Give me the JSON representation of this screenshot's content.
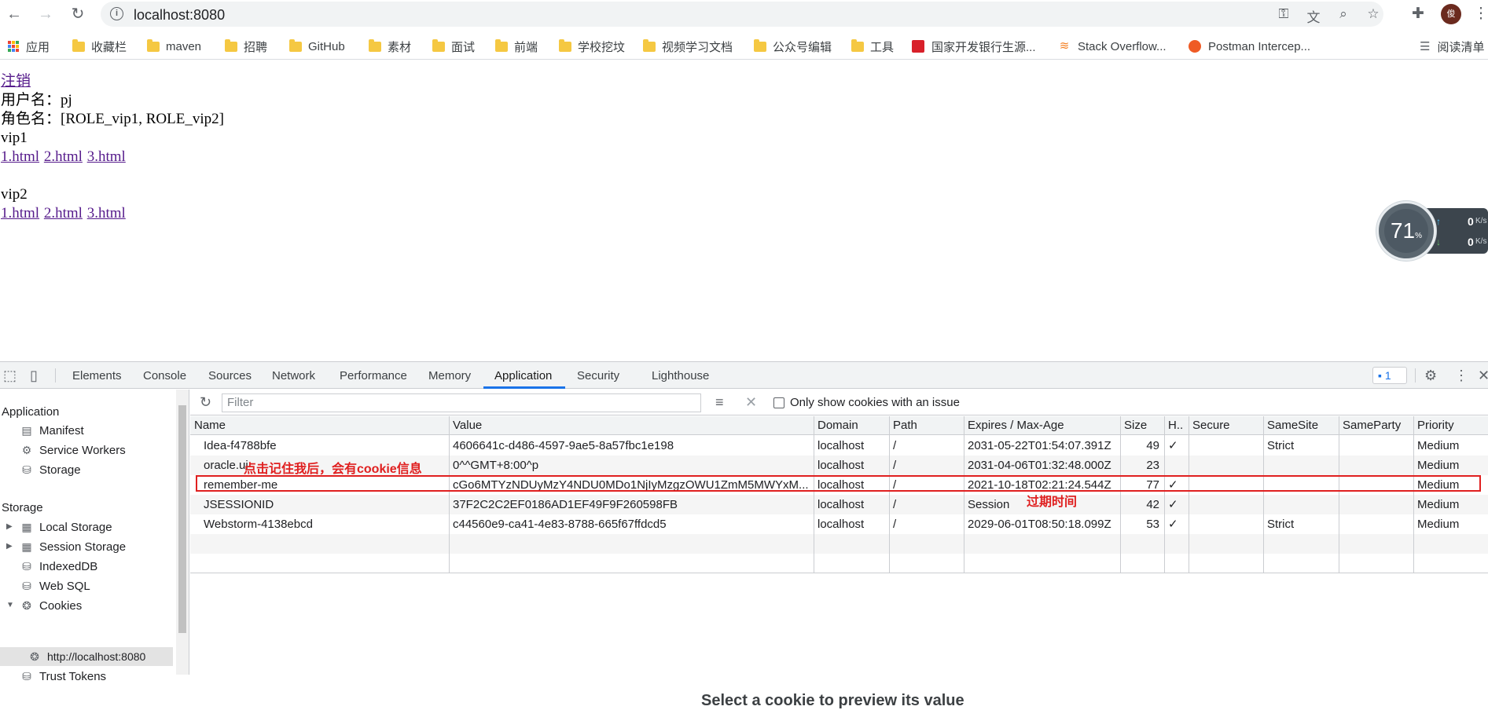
{
  "browser": {
    "url": "localhost:8080",
    "avatar_text": "俊",
    "bookmarks": [
      {
        "label": "应用",
        "type": "apps"
      },
      {
        "label": "收藏栏",
        "type": "folder"
      },
      {
        "label": "maven",
        "type": "folder"
      },
      {
        "label": "招聘",
        "type": "folder"
      },
      {
        "label": "GitHub",
        "type": "folder"
      },
      {
        "label": "素材",
        "type": "folder"
      },
      {
        "label": "面试",
        "type": "folder"
      },
      {
        "label": "前端",
        "type": "folder"
      },
      {
        "label": "学校挖坟",
        "type": "folder"
      },
      {
        "label": "视频学习文档",
        "type": "folder"
      },
      {
        "label": "公众号编辑",
        "type": "folder"
      },
      {
        "label": "工具",
        "type": "folder"
      },
      {
        "label": "国家开发银行生源...",
        "type": "site"
      },
      {
        "label": "Stack Overflow...",
        "type": "site"
      },
      {
        "label": "Postman Intercep...",
        "type": "site"
      },
      {
        "label": "阅读清单",
        "type": "reading-list"
      }
    ]
  },
  "page": {
    "logout": "注销",
    "username_line": "用户名：pj",
    "roles_line": "角色名：[ROLE_vip1, ROLE_vip2]",
    "sections": [
      {
        "title": "vip1",
        "links": [
          "1.html",
          "2.html",
          "3.html"
        ]
      },
      {
        "title": "vip2",
        "links": [
          "1.html",
          "2.html",
          "3.html"
        ]
      }
    ]
  },
  "net_widget": {
    "percent": "71",
    "percent_unit": "%",
    "up_value": "0",
    "down_value": "0",
    "unit": "K/s"
  },
  "devtools": {
    "tabs": [
      "Elements",
      "Console",
      "Sources",
      "Network",
      "Performance",
      "Memory",
      "Application",
      "Security",
      "Lighthouse"
    ],
    "active_tab": "Application",
    "issues_count": "1",
    "sidebar": {
      "application_header": "Application",
      "application_items": [
        "Manifest",
        "Service Workers",
        "Storage"
      ],
      "storage_header": "Storage",
      "storage_items": [
        "Local Storage",
        "Session Storage",
        "IndexedDB",
        "Web SQL",
        "Cookies"
      ],
      "cookie_origin": "http://localhost:8080",
      "trust_tokens": "Trust Tokens"
    },
    "filter_placeholder": "Filter",
    "only_issues_label": "Only show cookies with an issue",
    "columns": [
      "Name",
      "Value",
      "Domain",
      "Path",
      "Expires / Max-Age",
      "Size",
      "H..",
      "Secure",
      "SameSite",
      "SameParty",
      "Priority"
    ],
    "cookies": [
      {
        "name": "Idea-f4788bfe",
        "value": "4606641c-d486-4597-9ae5-8a57fbc1e198",
        "domain": "localhost",
        "path": "/",
        "expires": "2031-05-22T01:54:07.391Z",
        "size": "49",
        "http": "✓",
        "secure": "",
        "samesite": "Strict",
        "sameparty": "",
        "priority": "Medium"
      },
      {
        "name": "oracle.ui",
        "value": "0^^GMT+8:00^p",
        "domain": "localhost",
        "path": "/",
        "expires": "2031-04-06T01:32:48.000Z",
        "size": "23",
        "http": "",
        "secure": "",
        "samesite": "",
        "sameparty": "",
        "priority": "Medium"
      },
      {
        "name": "remember-me",
        "value": "cGo6MTYzNDUyMzY4NDU0MDo1NjIyMzgzOWU1ZmM5MWYxM...",
        "domain": "localhost",
        "path": "/",
        "expires": "2021-10-18T02:21:24.544Z",
        "size": "77",
        "http": "✓",
        "secure": "",
        "samesite": "",
        "sameparty": "",
        "priority": "Medium"
      },
      {
        "name": "JSESSIONID",
        "value": "37F2C2C2EF0186AD1EF49F9F260598FB",
        "domain": "localhost",
        "path": "/",
        "expires": "Session",
        "size": "42",
        "http": "✓",
        "secure": "",
        "samesite": "",
        "sameparty": "",
        "priority": "Medium"
      },
      {
        "name": "Webstorm-4138ebcd",
        "value": "c44560e9-ca41-4e83-8788-665f67ffdcd5",
        "domain": "localhost",
        "path": "/",
        "expires": "2029-06-01T08:50:18.099Z",
        "size": "53",
        "http": "✓",
        "secure": "",
        "samesite": "Strict",
        "sameparty": "",
        "priority": "Medium"
      }
    ],
    "annotation_remember": "点击记住我后，会有cookie信息",
    "annotation_expiry": "过期时间",
    "preview_text": "Select a cookie to preview its value"
  },
  "colors": {
    "link_visited": "#551a8b",
    "annotation_red": "#e02020",
    "active_tab_blue": "#1a73e8"
  }
}
